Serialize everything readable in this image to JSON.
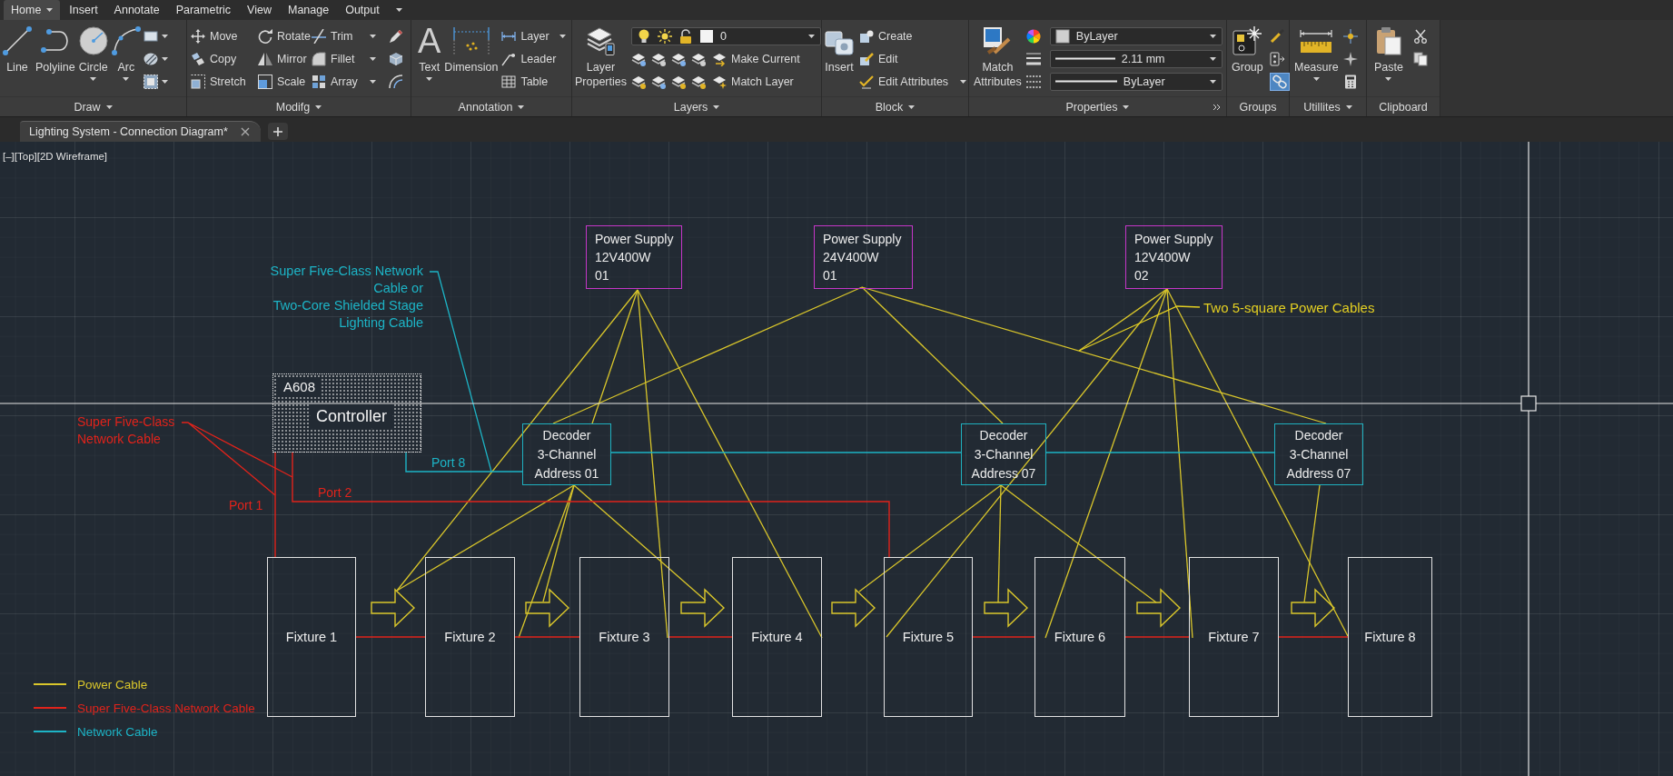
{
  "ribbon": {
    "tabs": [
      {
        "label": "Home",
        "selected": true
      },
      {
        "label": "Insert",
        "selected": false
      },
      {
        "label": "Annotate",
        "selected": false
      },
      {
        "label": "Parametric",
        "selected": false
      },
      {
        "label": "View",
        "selected": false
      },
      {
        "label": "Manage",
        "selected": false
      },
      {
        "label": "Output",
        "selected": false
      }
    ],
    "panels": [
      {
        "kind": "draw",
        "title": "Draw",
        "large_buttons": [
          "Line",
          "Polyiine",
          "Circle",
          "Arc"
        ]
      },
      {
        "kind": "modify",
        "title": "Modifg",
        "buttons": [
          "Move",
          "Rotate",
          "Trim",
          "Copy",
          "Mirror",
          "Fillet",
          "Stretch",
          "Scale",
          "Array"
        ]
      },
      {
        "kind": "annotation",
        "title": "Annotation",
        "text_glyph": "A",
        "large_buttons": [
          "Text",
          "Dimension"
        ],
        "buttons": [
          "Layer",
          "Leader",
          "Table"
        ]
      },
      {
        "kind": "layers",
        "title": "Layers",
        "large_buttons": [
          "Layer Properties"
        ],
        "current_layer": "0",
        "buttons": [
          "Make Current",
          "Match Layer"
        ]
      },
      {
        "kind": "block",
        "title": "Block",
        "large_buttons": [
          "Insert"
        ],
        "buttons": [
          "Create",
          "Edit",
          "Edit Attributes"
        ]
      },
      {
        "kind": "properties",
        "title": "Properties",
        "large_buttons": [
          "Match Attributes"
        ],
        "dropdowns": [
          "ByLayer",
          "2.11 mm",
          "ByLayer"
        ]
      },
      {
        "kind": "groups",
        "title": "Groups",
        "large_buttons": [
          "Group"
        ],
        "selection_toggle_on": true
      },
      {
        "kind": "utilities",
        "title": "Utillites",
        "large_buttons": [
          "Measure"
        ]
      },
      {
        "kind": "clipboard",
        "title": "Clipboard",
        "large_buttons": [
          "Paste"
        ]
      }
    ]
  },
  "document_tabs": [
    {
      "label": "Lighting System - Connection Diagram*",
      "selected": true
    }
  ],
  "viewport_controls": [
    "[–]",
    "[Top]",
    "[2D Wireframe]"
  ],
  "diagram": {
    "power_supplies": [
      {
        "title": "Power Supply",
        "rating": "12V400W",
        "number": "01"
      },
      {
        "title": "Power Supply",
        "rating": "24V400W",
        "number": "01"
      },
      {
        "title": "Power Supply",
        "rating": "12V400W",
        "number": "02"
      }
    ],
    "controller": {
      "model": "A608",
      "title": "Controller"
    },
    "decoders": [
      {
        "title": "Decoder",
        "channels": "3-Channel",
        "address": "Address 01"
      },
      {
        "title": "Decoder",
        "channels": "3-Channel",
        "address": "Address 07"
      },
      {
        "title": "Decoder",
        "channels": "3-Channel",
        "address": "Address 07"
      }
    ],
    "fixtures": [
      "Fixture 1",
      "Fixture 2",
      "Fixture 3",
      "Fixture 4",
      "Fixture 5",
      "Fixture 6",
      "Fixture 7",
      "Fixture 8"
    ],
    "notes": [
      {
        "lines": [
          "Super Five-Class Network",
          "Cable or",
          "Two-Core Shielded Stage",
          "Lighting Cable"
        ],
        "color": "#1db4c6"
      },
      {
        "lines": [
          "Super Five-Class",
          "Network Cable"
        ],
        "color": "#e0231b"
      },
      {
        "lines": [
          "Two 5-square Power Cables"
        ],
        "color": "#e3cf22"
      }
    ],
    "port_labels": [
      {
        "text": "Port 8",
        "color": "#1db4c6"
      },
      {
        "text": "Port 2",
        "color": "#e0231b"
      },
      {
        "text": "Port 1",
        "color": "#e0231b"
      }
    ]
  },
  "legend": [
    {
      "label": "Power Cable",
      "color": "#d9c62b"
    },
    {
      "label": "Super Five-Class Network Cable",
      "color": "#e0231b"
    },
    {
      "label": "Network Cable",
      "color": "#1db4c6"
    }
  ]
}
